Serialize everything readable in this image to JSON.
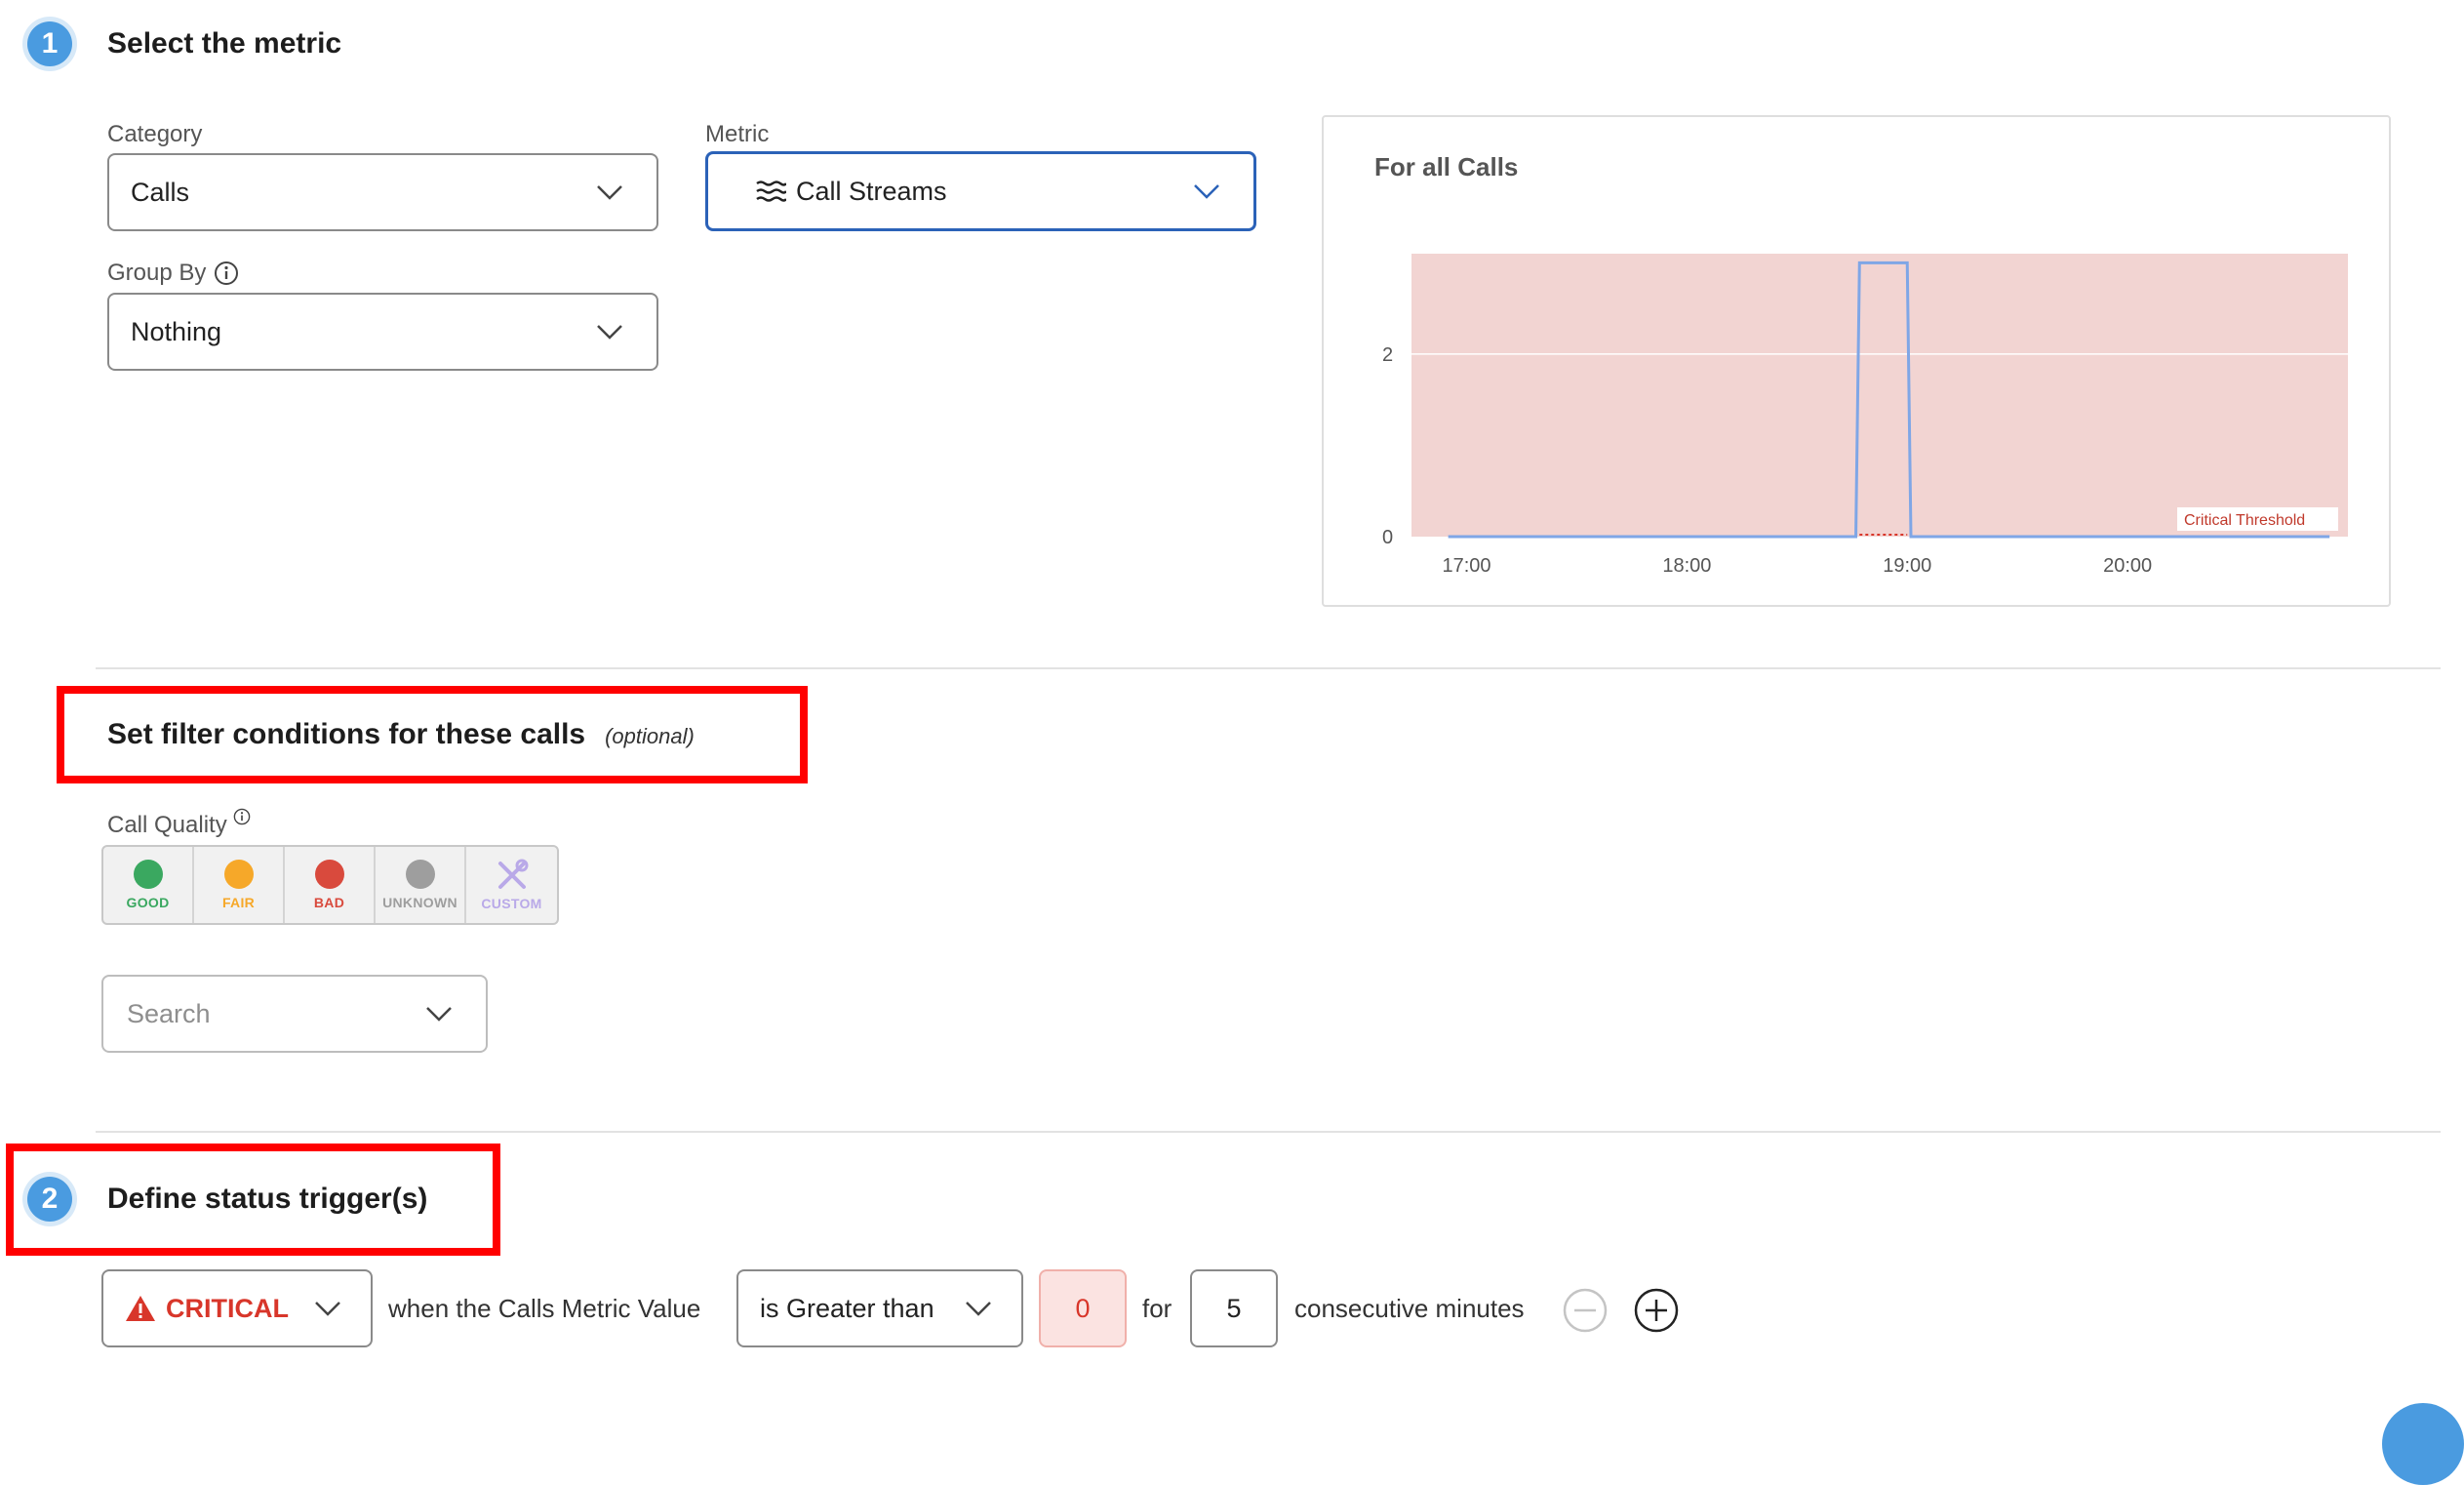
{
  "step1": {
    "number": "1",
    "title": "Select the metric"
  },
  "category": {
    "label": "Category",
    "value": "Calls"
  },
  "metric": {
    "label": "Metric",
    "value": "Call Streams",
    "icon": "waves-icon"
  },
  "group_by": {
    "label": "Group By",
    "value": "Nothing",
    "info_icon": "info-icon"
  },
  "chart_panel": {
    "title": "For all Calls",
    "threshold_label": "Critical Threshold"
  },
  "chart_data": {
    "type": "line",
    "title": "For all Calls",
    "x_tick_labels": [
      "17:00",
      "18:00",
      "19:00",
      "20:00"
    ],
    "y_tick_labels": [
      "2",
      "0"
    ],
    "ylim": [
      0,
      3.1
    ],
    "series": [
      {
        "x": [
          "16:55",
          "18:46",
          "18:47",
          "19:00",
          "19:01",
          "20:55"
        ],
        "values": [
          0,
          0,
          3,
          3,
          0,
          0
        ]
      }
    ],
    "threshold": {
      "label": "Critical Threshold",
      "value": 0,
      "color": "#f2d4d2"
    },
    "grid": true
  },
  "filter": {
    "title": "Set filter conditions for these calls",
    "optional": "(optional)"
  },
  "call_quality": {
    "label": "Call Quality",
    "options": [
      {
        "label": "GOOD",
        "color": "#3aa860"
      },
      {
        "label": "FAIR",
        "color": "#f6a829"
      },
      {
        "label": "BAD",
        "color": "#d94a3d"
      },
      {
        "label": "UNKNOWN",
        "color": "#9e9e9e"
      },
      {
        "label": "CUSTOM",
        "color": "#b9a9e8"
      }
    ]
  },
  "search": {
    "placeholder": "Search"
  },
  "step2": {
    "number": "2",
    "title": "Define status trigger(s)"
  },
  "trigger": {
    "severity": "CRITICAL",
    "severity_color": "#d8362a",
    "when_text": "when the Calls Metric Value",
    "operator": "is Greater than",
    "threshold_value": "0",
    "for_text": "for",
    "minutes_value": "5",
    "suffix": "consecutive minutes"
  }
}
